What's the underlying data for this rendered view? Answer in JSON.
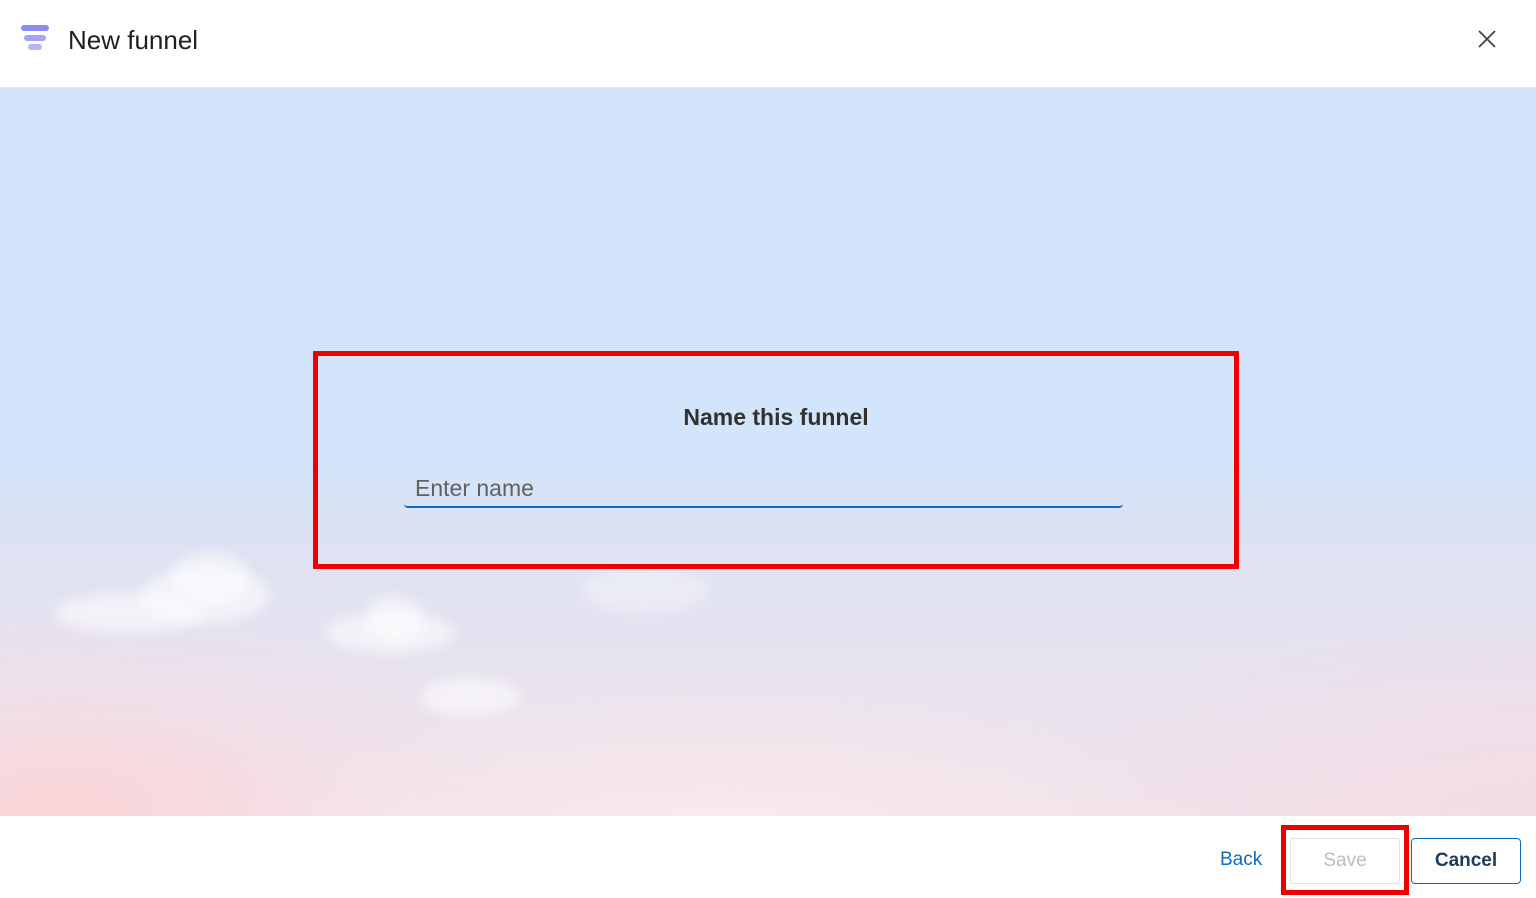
{
  "header": {
    "title": "New funnel",
    "logo_icon": "funnel-icon",
    "close_icon": "close-icon"
  },
  "dialog": {
    "heading": "Name this funnel",
    "name_input": {
      "placeholder": "Enter name",
      "value": ""
    }
  },
  "footer": {
    "back_label": "Back",
    "save_label": "Save",
    "cancel_label": "Cancel"
  },
  "colors": {
    "accent": "#0f6cbd",
    "logo": "#8b8bf5",
    "highlight": "#ee0000",
    "sky": "#d2e5fa"
  }
}
